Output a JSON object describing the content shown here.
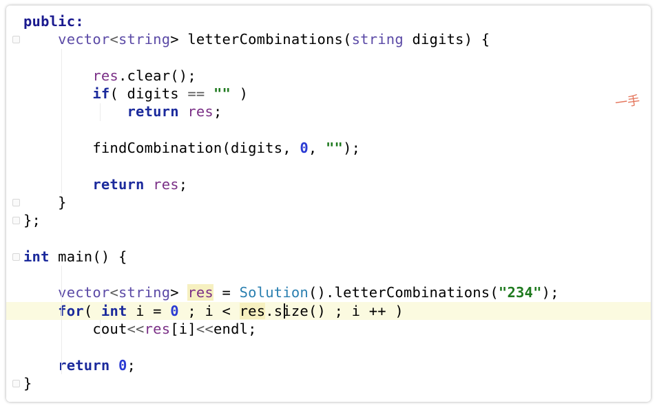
{
  "editor": {
    "lines": [
      [
        {
          "t": "public",
          "c": "kwp"
        },
        {
          "t": ":",
          "c": "kwp"
        }
      ],
      [
        {
          "t": "    "
        },
        {
          "t": "vector",
          "c": "type"
        },
        {
          "t": "<",
          "c": "op"
        },
        {
          "t": "string",
          "c": "type"
        },
        {
          "t": "> letterCombinations("
        },
        {
          "t": "string",
          "c": "type"
        },
        {
          "t": " digits) {"
        }
      ],
      [
        {
          "t": ""
        }
      ],
      [
        {
          "t": "        "
        },
        {
          "t": "res",
          "c": "var"
        },
        {
          "t": ".clear();"
        }
      ],
      [
        {
          "t": "        "
        },
        {
          "t": "if",
          "c": "kw"
        },
        {
          "t": "( digits "
        },
        {
          "t": "==",
          "c": "op"
        },
        {
          "t": " "
        },
        {
          "t": "\"\"",
          "c": "str"
        },
        {
          "t": " )"
        }
      ],
      [
        {
          "t": "            "
        },
        {
          "t": "return",
          "c": "kw"
        },
        {
          "t": " "
        },
        {
          "t": "res",
          "c": "var"
        },
        {
          "t": ";"
        }
      ],
      [
        {
          "t": ""
        }
      ],
      [
        {
          "t": "        findCombination(digits, "
        },
        {
          "t": "0",
          "c": "num"
        },
        {
          "t": ", "
        },
        {
          "t": "\"\"",
          "c": "str"
        },
        {
          "t": ");"
        }
      ],
      [
        {
          "t": ""
        }
      ],
      [
        {
          "t": "        "
        },
        {
          "t": "return",
          "c": "kw"
        },
        {
          "t": " "
        },
        {
          "t": "res",
          "c": "var"
        },
        {
          "t": ";"
        }
      ],
      [
        {
          "t": "    }"
        }
      ],
      [
        {
          "t": "};"
        }
      ],
      [
        {
          "t": ""
        }
      ],
      [
        {
          "t": "int",
          "c": "kw"
        },
        {
          "t": " main() {"
        }
      ],
      [
        {
          "t": ""
        }
      ],
      [
        {
          "t": "    "
        },
        {
          "t": "vector",
          "c": "type"
        },
        {
          "t": "<",
          "c": "op"
        },
        {
          "t": "string",
          "c": "type"
        },
        {
          "t": "> "
        },
        {
          "t": "res",
          "c": "var hl"
        },
        {
          "t": " = "
        },
        {
          "t": "Solution",
          "c": "cls"
        },
        {
          "t": "().letterCombinations("
        },
        {
          "t": "\"234\"",
          "c": "str"
        },
        {
          "t": ");"
        }
      ],
      [
        {
          "t": "    "
        },
        {
          "t": "for",
          "c": "kw"
        },
        {
          "t": "( "
        },
        {
          "t": "int",
          "c": "kw"
        },
        {
          "t": " i = "
        },
        {
          "t": "0",
          "c": "num"
        },
        {
          "t": " ; i < "
        },
        {
          "t": "res",
          "c": "hl"
        },
        {
          "t": ".size() ; i ++ )"
        }
      ],
      [
        {
          "t": "        cout"
        },
        {
          "t": "<<",
          "c": "op"
        },
        {
          "t": "res",
          "c": "var"
        },
        {
          "t": "[i]"
        },
        {
          "t": "<<",
          "c": "op"
        },
        {
          "t": "endl;"
        }
      ],
      [
        {
          "t": ""
        }
      ],
      [
        {
          "t": "    "
        },
        {
          "t": "return",
          "c": "kw"
        },
        {
          "t": " "
        },
        {
          "t": "0",
          "c": "num"
        },
        {
          "t": ";"
        }
      ],
      [
        {
          "t": "}"
        }
      ]
    ],
    "active_line": 16,
    "fold_lines": [
      1,
      10,
      11,
      13,
      20
    ],
    "margin_note": "一手"
  }
}
